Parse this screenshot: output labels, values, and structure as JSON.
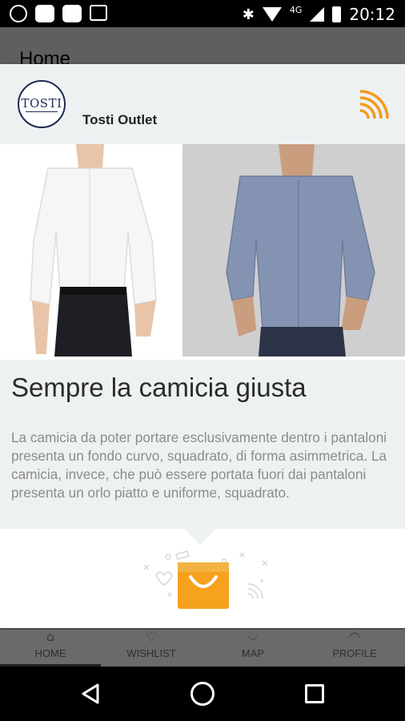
{
  "status_bar": {
    "network": "4G",
    "time": "20:12"
  },
  "app_bar": {
    "title": "Home"
  },
  "dialog": {
    "store_name": "Tosti Outlet",
    "logo_text": "TOSTI",
    "headline": "Sempre la camicia giusta",
    "body": "La camicia da poter portare esclusivamente dentro i pantaloni presenta un fondo curvo, squadrato, di forma asimmetrica. La camicia, invece, che può essere portata fuori dai pantaloni presenta un orlo piatto e uniforme, squadrato.",
    "images": [
      "white-shirt-photo",
      "blue-shirt-photo"
    ],
    "accent_color": "#f39a1e"
  },
  "bottom_nav": {
    "items": [
      {
        "label": "HOME",
        "icon": "home-icon"
      },
      {
        "label": "WISHLIST",
        "icon": "heart-icon"
      },
      {
        "label": "MAP",
        "icon": "map-pin-icon"
      },
      {
        "label": "PROFILE",
        "icon": "person-icon"
      }
    ]
  }
}
